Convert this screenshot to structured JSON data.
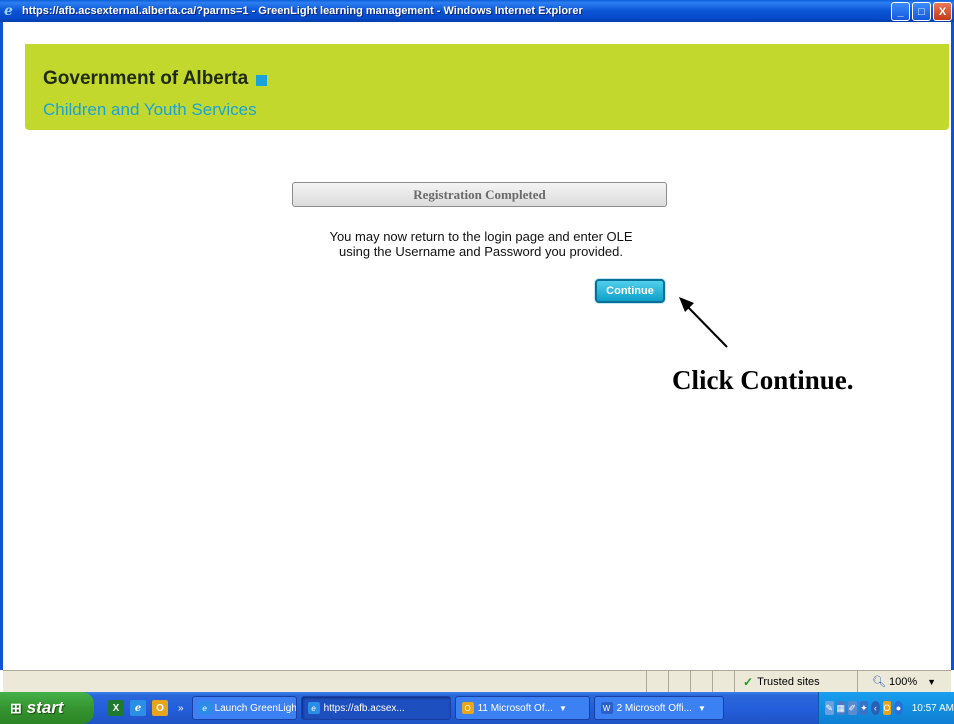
{
  "window": {
    "title": "https://afb.acsexternal.alberta.ca/?parms=1 - GreenLight learning management - Windows Internet Explorer",
    "minimize": "_",
    "maximize": "□",
    "close": "X"
  },
  "banner": {
    "org_name": "Government of Alberta",
    "department": "Children and Youth Services",
    "accent_color": "#c2d82c",
    "square_color": "#1aa3d8"
  },
  "registration": {
    "header": "Registration Completed",
    "message_line1": "You may now return to the login page and enter OLE",
    "message_line2": "using the Username and Password you provided.",
    "continue_label": "Continue"
  },
  "annotation": {
    "callout": "Click Continue."
  },
  "statusbar": {
    "zone": "Trusted sites",
    "zoom": "100%"
  },
  "taskbar": {
    "start_label": "start",
    "tasks": [
      {
        "label": "Launch GreenLigh...",
        "icon": "ie-icon"
      },
      {
        "label": "https://afb.acsex...",
        "icon": "ie-icon"
      },
      {
        "label": "11 Microsoft Of...",
        "icon": "outlook-icon"
      },
      {
        "label": "2 Microsoft Offi...",
        "icon": "word-icon"
      }
    ],
    "clock": "10:57 AM"
  }
}
